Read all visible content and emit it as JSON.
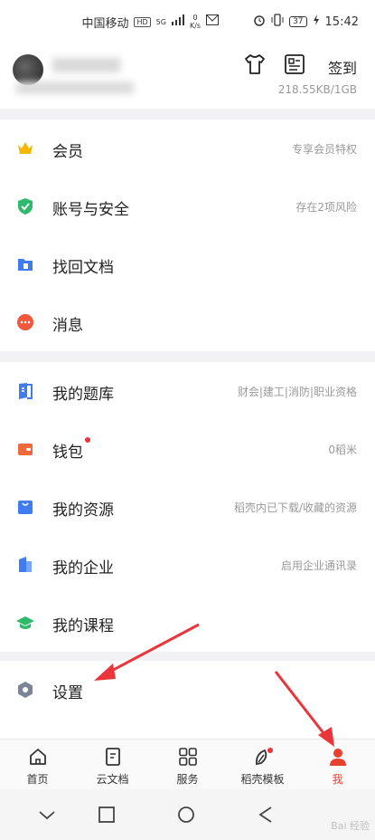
{
  "status": {
    "carrier": "中国移动",
    "hd": "HD",
    "net": "5G",
    "speed_value": "0",
    "speed_unit": "K/s",
    "battery": "37",
    "time": "15:42"
  },
  "header": {
    "storage": "218.55KB/1GB",
    "signin": "签到"
  },
  "menu_group1": [
    {
      "label": "会员",
      "hint": "专享会员特权"
    },
    {
      "label": "账号与安全",
      "hint": "存在2项风险"
    },
    {
      "label": "找回文档",
      "hint": ""
    },
    {
      "label": "消息",
      "hint": ""
    }
  ],
  "menu_group2": [
    {
      "label": "我的题库",
      "hint": "财会|建工|消防|职业资格"
    },
    {
      "label": "钱包",
      "hint": "0稻米"
    },
    {
      "label": "我的资源",
      "hint": "稻壳内已下载/收藏的资源"
    },
    {
      "label": "我的企业",
      "hint": "启用企业通讯录"
    },
    {
      "label": "我的课程",
      "hint": ""
    }
  ],
  "menu_group3": [
    {
      "label": "设置",
      "hint": ""
    }
  ],
  "tabs": [
    {
      "label": "首页"
    },
    {
      "label": "云文档"
    },
    {
      "label": "服务"
    },
    {
      "label": "稻壳模板"
    },
    {
      "label": "我"
    }
  ],
  "watermark": "Bai 经验",
  "colors": {
    "accent": "#e8402e",
    "crown": "#f5b800",
    "shield": "#2dbb6b",
    "blue": "#3f7cf0",
    "message": "#f0573b",
    "wallet": "#f06a3b",
    "grad": "#2dbb6b",
    "settings": "#7b8597"
  }
}
